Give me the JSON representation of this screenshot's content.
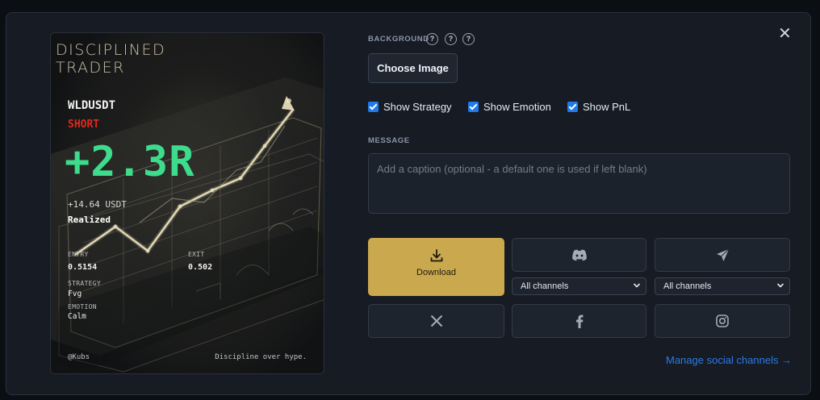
{
  "card": {
    "brand_line1": "DISCIPLINED",
    "brand_line2": "TRADER",
    "symbol": "WLDUSDT",
    "side": "SHORT",
    "r_multiple": "+2.3R",
    "pnl": "+14.64 USDT",
    "status": "Realized",
    "entry_label": "ENTRY",
    "entry_value": "0.5154",
    "exit_label": "EXIT",
    "exit_value": "0.502",
    "strategy_label": "STRATEGY",
    "strategy_value": "Fvg",
    "emotion_label": "EMOTION",
    "emotion_value": "Calm",
    "handle": "@Kubs",
    "tagline": "Discipline over hype."
  },
  "background": {
    "label": "BACKGROUND",
    "help": [
      "?",
      "?",
      "?"
    ],
    "choose_label": "Choose Image"
  },
  "options": {
    "show_strategy": "Show Strategy",
    "show_emotion": "Show Emotion",
    "show_pnl": "Show PnL"
  },
  "message": {
    "label": "MESSAGE",
    "placeholder": "Add a caption (optional - a default one is used if left blank)"
  },
  "share": {
    "download_label": "Download",
    "discord_select": "All channels",
    "telegram_select": "All channels",
    "icons": [
      "download-icon",
      "discord-icon",
      "telegram-icon",
      "x-icon",
      "facebook-icon",
      "instagram-icon"
    ]
  },
  "manage_link": "Manage social channels →",
  "close_glyph": "✕",
  "colors": {
    "accent_gold": "#c9a84e",
    "r_green": "#3ddc8c",
    "short_red": "#e0281e",
    "link_blue": "#2c7be5"
  }
}
